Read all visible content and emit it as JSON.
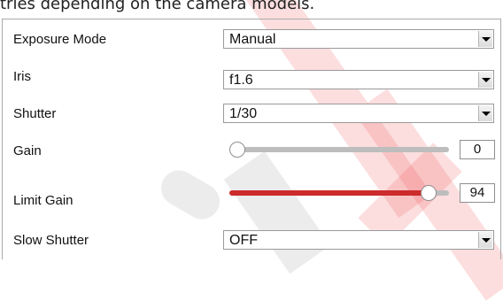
{
  "header": {
    "text": "tries depending on the camera models."
  },
  "settings": {
    "exposure_mode": {
      "label": "Exposure Mode",
      "value": "Manual"
    },
    "iris": {
      "label": "Iris",
      "value": "f1.6"
    },
    "shutter": {
      "label": "Shutter",
      "value": "1/30"
    },
    "gain": {
      "label": "Gain",
      "value": "0",
      "level_fraction": 0.0
    },
    "limit_gain": {
      "label": "Limit Gain",
      "value": "94",
      "level_fraction": 0.94
    },
    "slow_shutter": {
      "label": "Slow Shutter",
      "value": "OFF"
    }
  },
  "colors": {
    "slider_fill": "#cc2b2b",
    "slider_track": "#bdbdbd",
    "watermark": "#ec4650"
  },
  "icons": {
    "dropdown": "chevron-down-icon"
  }
}
